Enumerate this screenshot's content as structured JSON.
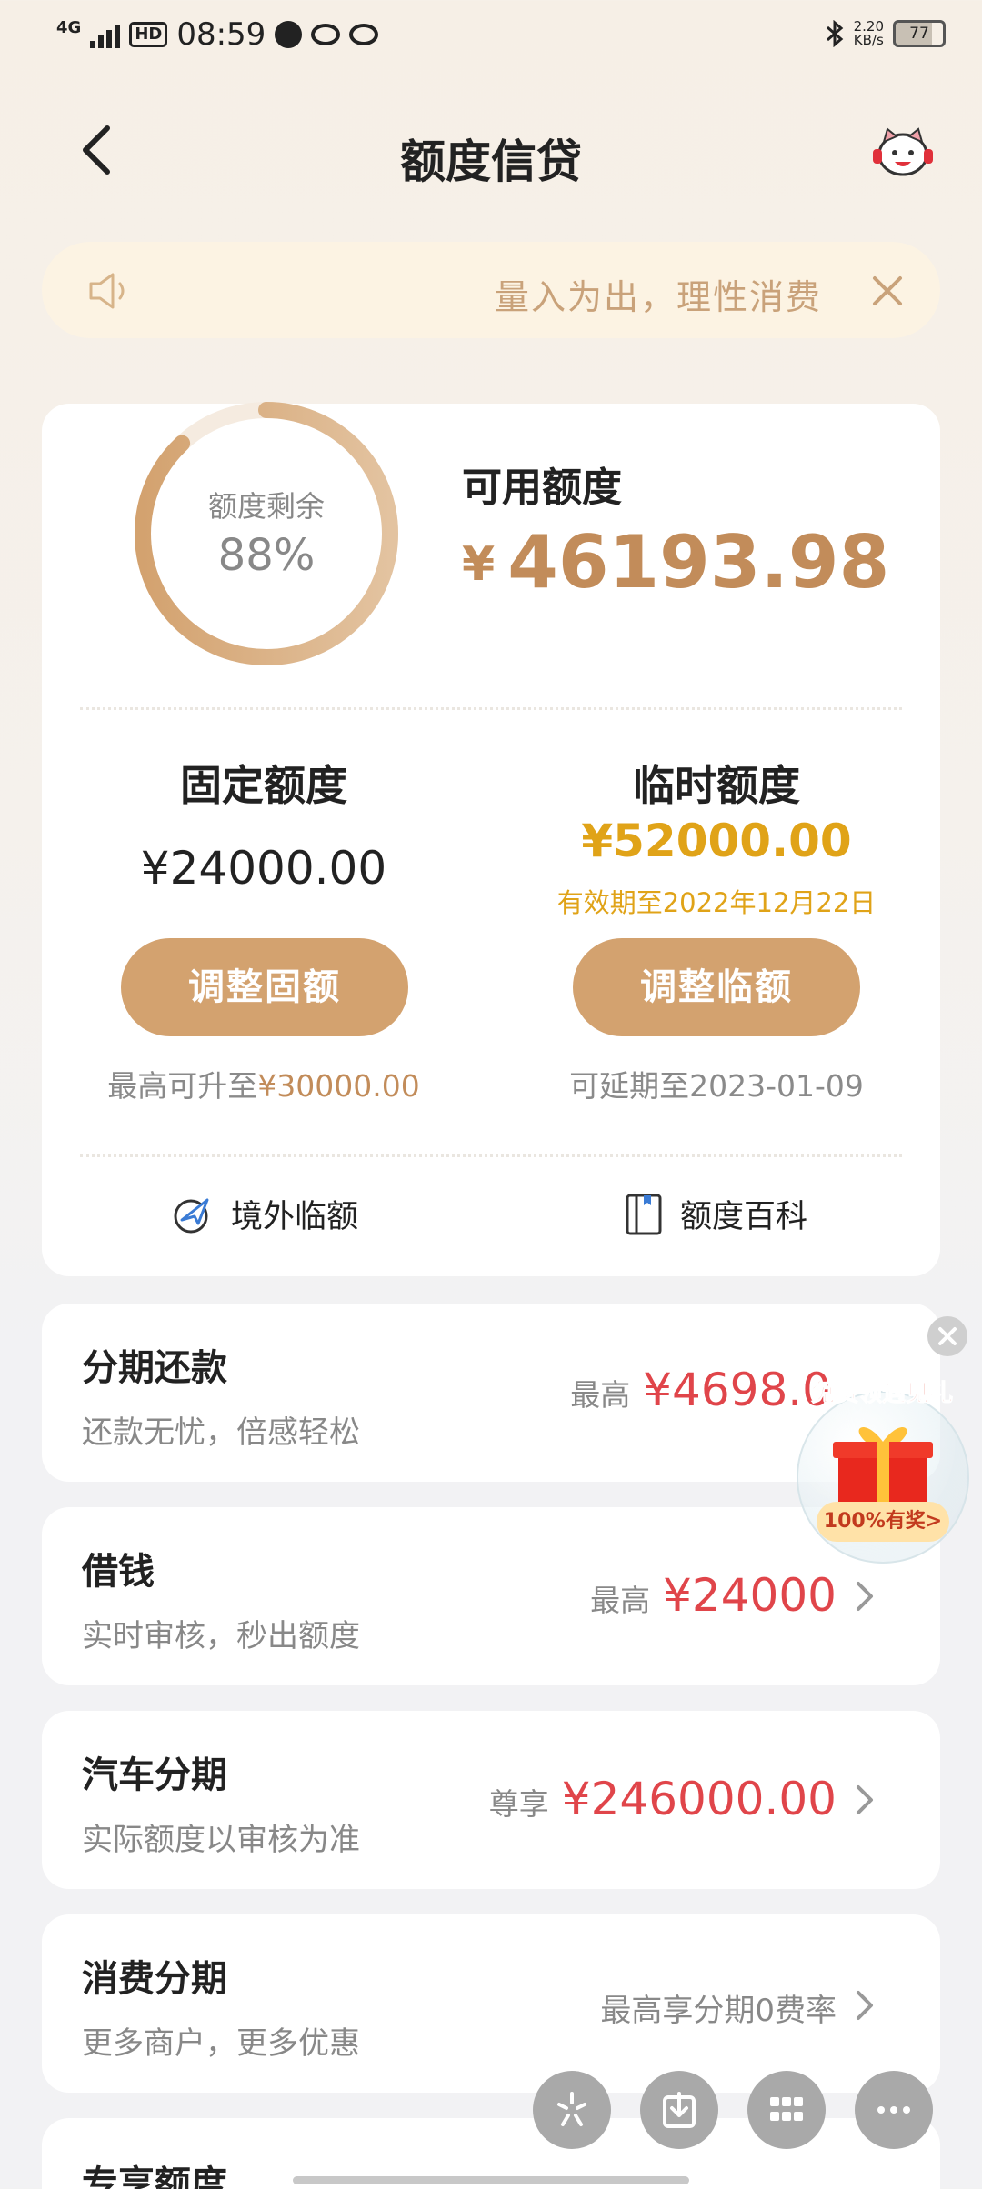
{
  "status_bar": {
    "network": "4G",
    "hd": "HD",
    "time": "08:59",
    "speed_value": "2.20",
    "speed_unit": "KB/s",
    "battery": "77"
  },
  "header": {
    "title": "额度信贷"
  },
  "notice": {
    "text": "量入为出，理性消费"
  },
  "credit": {
    "remaining_label": "额度剩余",
    "remaining_percent": "88%",
    "remaining_fraction": 0.88,
    "available_label": "可用额度",
    "currency": "¥",
    "available_amount": "46193.98",
    "fixed": {
      "title": "固定额度",
      "amount": "¥24000.00",
      "button": "调整固额",
      "note_prefix": "最高可升至",
      "note_value": "¥30000.00"
    },
    "temporary": {
      "title": "临时额度",
      "amount": "¥52000.00",
      "valid_until": "有效期至2022年12月22日",
      "button": "调整临额",
      "note": "可延期至2023-01-09"
    },
    "links": {
      "overseas": "境外临额",
      "wiki": "额度百科"
    }
  },
  "products": [
    {
      "title": "分期还款",
      "subtitle": "还款无忧，倍感轻松",
      "label": "最高",
      "amount": "¥4698.0"
    },
    {
      "title": "借钱",
      "subtitle": "实时审核，秒出额度",
      "label": "最高",
      "amount": "¥24000"
    },
    {
      "title": "汽车分期",
      "subtitle": "实际额度以审核为准",
      "label": "尊享",
      "amount": "¥246000.00"
    },
    {
      "title": "消费分期",
      "subtitle": "更多商户，更多优惠",
      "text": "最高享分期0费率"
    },
    {
      "title": "专享额度"
    }
  ],
  "gift": {
    "banner": "免费领遇见礼",
    "tag": "100%有奖>"
  },
  "colors": {
    "accent": "#d3a26f",
    "gold_text": "#c28c5a",
    "temp_yellow": "#e0a318",
    "red_amount": "#e0454a"
  }
}
